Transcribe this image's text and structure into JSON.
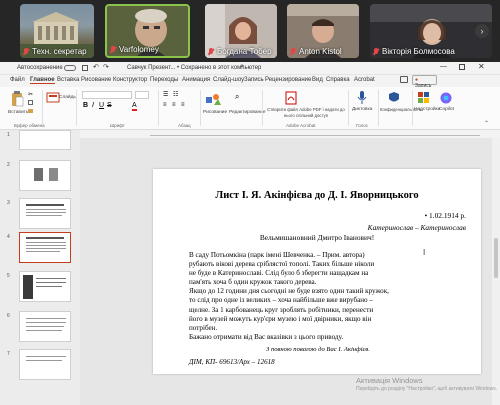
{
  "meeting": {
    "participants": [
      {
        "name": "Техн. секретар",
        "muted": true
      },
      {
        "name": "Varfolomey",
        "muted": true
      },
      {
        "name": "Богдана Тобер",
        "muted": true
      },
      {
        "name": "Anton Kistol",
        "muted": true
      },
      {
        "name": "Вікторія Болмосова",
        "muted": true
      }
    ]
  },
  "app": {
    "autosave_label": "Автосохранение",
    "file_title": "Савчук Презент... • Сохранено в этот компьютер",
    "tabs": [
      "Файл",
      "Главное",
      "Вставка",
      "Рисование",
      "Конструктор",
      "Переходы",
      "Анимация",
      "Слайд-шоу",
      "Запись",
      "Рецензирование",
      "Вид",
      "Справка",
      "Acrobat"
    ],
    "active_tab": "Главное",
    "ribbon": {
      "paste": "Вставить",
      "slides": "Слайды",
      "groups": [
        "Буфер обмена",
        "Шрифт",
        "Абзац",
        "Adobe Acrobat",
        "Голос",
        "Конфиденциальность",
        "Надстройки"
      ],
      "drawing": "Рисование",
      "editing": "Редактирование",
      "acrobat_btn": "Створити файл Adobe PDF і надати до нього спільний доступ",
      "dictate": "Диктовка",
      "sensitivity": "Конфиденциальность",
      "addins": "Надстройки",
      "copilot": "Copilot",
      "record": "Запись"
    },
    "slide_numbers": [
      "1",
      "2",
      "3",
      "4",
      "5",
      "6",
      "7"
    ]
  },
  "slide": {
    "title": "Лист І. Я. Акінфієва до Д. І. Яворницького",
    "date": "1.02.1914 р.",
    "place": "Катеринослав – Катеринослав",
    "greeting": "Вельмишановний Дмитро Іванович!",
    "body": [
      "В саду Потьомкіна (парк імені Шевченка. – Прим. автора)",
      "рубають вікові дерева сріблястої тополі. Таких більше ніколи",
      "не буде в Катеринославі. Слід було б зберегти нащадкам на",
      "пам'ять хоча б один кружок такого дерева.",
      "Якщо до 12 години дня сьогодні не буде взято один такий кружок,",
      "то слід про одне із великих – хоча найбільше вже вирубано –",
      "щелне. За 1 карбованець круг зроблять робітники, перенести",
      "його в музей можуть кур'єри музею і мої двірники, якщо він",
      "потрібен.",
      "Бажано отримати від Вас вказівки з цього приводу."
    ],
    "signature": "З повною повагою до Вас І. Акінфієв.",
    "reference": "ДІМ, КП- 69613/Арх – 12618"
  },
  "watermark": {
    "line1": "Активація Windows",
    "line2": "Перейдіть до розділу \"Настройки\", щоб активувати Windows."
  }
}
